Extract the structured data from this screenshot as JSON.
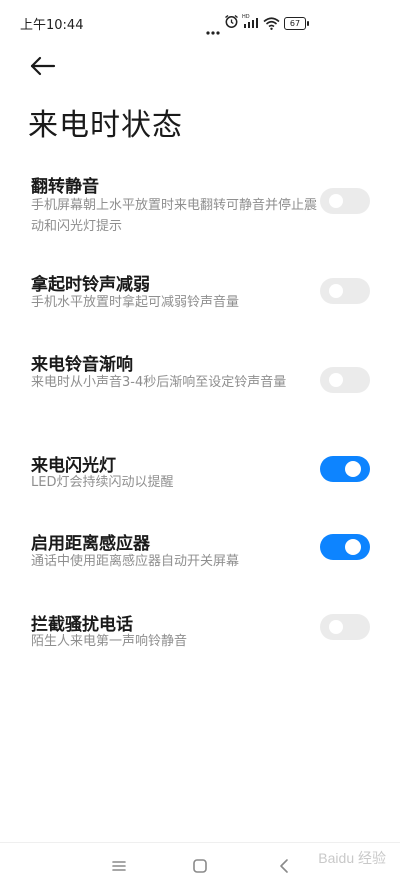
{
  "status_bar": {
    "time": "上午10:44",
    "battery": "67",
    "icons": [
      "more-dots-icon",
      "alarm-icon",
      "hd-signal-icon",
      "wifi-icon",
      "battery-icon"
    ]
  },
  "header": {
    "back_icon": "back-arrow-icon",
    "title": "来电时状态"
  },
  "settings": [
    {
      "title": "翻转静音",
      "description": "手机屏幕朝上水平放置时来电翻转可静音并停止震动和闪光灯提示",
      "enabled": false
    },
    {
      "title": "拿起时铃声减弱",
      "description": "手机水平放置时拿起可减弱铃声音量",
      "enabled": false
    },
    {
      "title": "来电铃音渐响",
      "description": "来电时从小声音3-4秒后渐响至设定铃声音量",
      "enabled": false
    },
    {
      "title": "来电闪光灯",
      "description": "LED灯会持续闪动以提醒",
      "enabled": true
    },
    {
      "title": "启用距离感应器",
      "description": "通话中使用距离感应器自动开关屏幕",
      "enabled": true
    },
    {
      "title": "拦截骚扰电话",
      "description": "陌生人来电第一声响铃静音",
      "enabled": false
    }
  ],
  "nav_bar": {
    "menu_icon": "menu-icon",
    "home_icon": "home-icon",
    "back_icon": "back-icon"
  },
  "watermark": "Baidu 经验",
  "colors": {
    "accent": "#0d84ff",
    "toggle_off": "#ebebeb",
    "description_text": "#8f8f8f"
  }
}
